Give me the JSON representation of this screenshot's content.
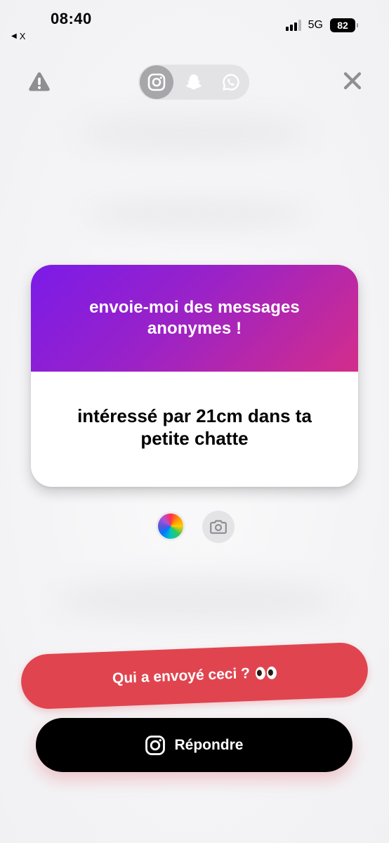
{
  "status_bar": {
    "time": "08:40",
    "back_app": "X",
    "network": "5G",
    "battery": "82"
  },
  "icons": {
    "report": "warning-icon",
    "close": "close-icon",
    "platforms": [
      "instagram-icon",
      "snapchat-icon",
      "whatsapp-icon"
    ],
    "selected_platform": "instagram-icon",
    "color_picker": "color-wheel-icon",
    "camera": "camera-icon"
  },
  "card": {
    "title": "envoie-moi des messages anonymes !",
    "message": "intéressé par 21cm dans ta petite chatte"
  },
  "actions": {
    "who_sent_label": "Qui a envoyé ceci ?",
    "reply_label": "Répondre"
  },
  "colors": {
    "gradient_start": "#7b1be8",
    "gradient_end": "#d42d8a",
    "who_button": "#e0454f",
    "reply_button": "#000000"
  }
}
